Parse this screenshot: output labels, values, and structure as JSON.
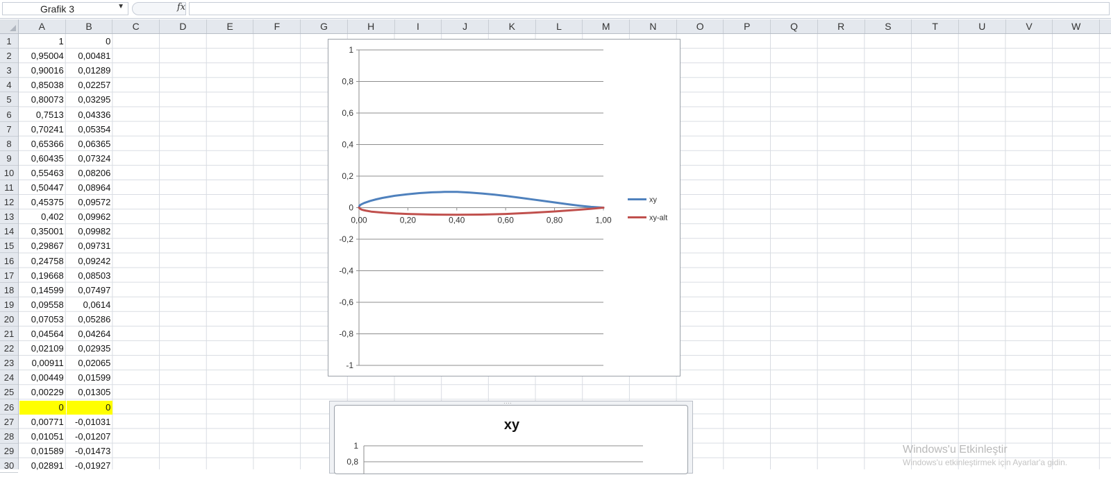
{
  "formula_bar": {
    "name_box": "Grafik 3",
    "fx_icon": "function-icon",
    "formula": ""
  },
  "columns": [
    "A",
    "B",
    "C",
    "D",
    "E",
    "F",
    "G",
    "H",
    "I",
    "J",
    "K",
    "L",
    "M",
    "N",
    "O",
    "P",
    "Q",
    "R",
    "S",
    "T",
    "U",
    "V",
    "W"
  ],
  "rows": [
    "1",
    "2",
    "3",
    "4",
    "5",
    "6",
    "7",
    "8",
    "9",
    "10",
    "11",
    "12",
    "13",
    "14",
    "15",
    "16",
    "17",
    "18",
    "19",
    "20",
    "21",
    "22",
    "23",
    "24",
    "25",
    "26",
    "27",
    "28",
    "29",
    "30"
  ],
  "cells": [
    [
      "1",
      "0"
    ],
    [
      "0,95004",
      "0,00481"
    ],
    [
      "0,90016",
      "0,01289"
    ],
    [
      "0,85038",
      "0,02257"
    ],
    [
      "0,80073",
      "0,03295"
    ],
    [
      "0,7513",
      "0,04336"
    ],
    [
      "0,70241",
      "0,05354"
    ],
    [
      "0,65366",
      "0,06365"
    ],
    [
      "0,60435",
      "0,07324"
    ],
    [
      "0,55463",
      "0,08206"
    ],
    [
      "0,50447",
      "0,08964"
    ],
    [
      "0,45375",
      "0,09572"
    ],
    [
      "0,402",
      "0,09962"
    ],
    [
      "0,35001",
      "0,09982"
    ],
    [
      "0,29867",
      "0,09731"
    ],
    [
      "0,24758",
      "0,09242"
    ],
    [
      "0,19668",
      "0,08503"
    ],
    [
      "0,14599",
      "0,07497"
    ],
    [
      "0,09558",
      "0,0614"
    ],
    [
      "0,07053",
      "0,05286"
    ],
    [
      "0,04564",
      "0,04264"
    ],
    [
      "0,02109",
      "0,02935"
    ],
    [
      "0,00911",
      "0,02065"
    ],
    [
      "0,00449",
      "0,01599"
    ],
    [
      "0,00229",
      "0,01305"
    ],
    [
      "0",
      "0"
    ],
    [
      "0,00771",
      "-0,01031"
    ],
    [
      "0,01051",
      "-0,01207"
    ],
    [
      "0,01589",
      "-0,01473"
    ],
    [
      "0,02891",
      "-0,01927"
    ]
  ],
  "highlight_row": 26,
  "highlight_color": "#ffff00",
  "chart_data": [
    {
      "type": "line",
      "title": "",
      "x_ticks": [
        "0,00",
        "0,20",
        "0,40",
        "0,60",
        "0,80",
        "1,00"
      ],
      "y_ticks": [
        "1",
        "0,8",
        "0,6",
        "0,4",
        "0,2",
        "0",
        "-0,2",
        "-0,4",
        "-0,6",
        "-0,8",
        "-1"
      ],
      "xlim": [
        0,
        1
      ],
      "ylim": [
        -1,
        1
      ],
      "grid": true,
      "legend": "right",
      "series": [
        {
          "name": "xy",
          "color": "#4f81bd",
          "x": [
            0,
            0.00229,
            0.00449,
            0.00911,
            0.02109,
            0.04564,
            0.07053,
            0.09558,
            0.14599,
            0.19668,
            0.24758,
            0.29867,
            0.35001,
            0.402,
            0.45375,
            0.50447,
            0.55463,
            0.60435,
            0.65366,
            0.70241,
            0.7513,
            0.80073,
            0.85038,
            0.90016,
            0.95004,
            1
          ],
          "y": [
            0,
            0.01305,
            0.01599,
            0.02065,
            0.02935,
            0.04264,
            0.05286,
            0.0614,
            0.07497,
            0.08503,
            0.09242,
            0.09731,
            0.09982,
            0.09962,
            0.09572,
            0.08964,
            0.08206,
            0.07324,
            0.06365,
            0.05354,
            0.04336,
            0.03295,
            0.02257,
            0.01289,
            0.00481,
            0
          ]
        },
        {
          "name": "xy-alt",
          "color": "#c0504d",
          "x": [
            0,
            0.00771,
            0.01051,
            0.01589,
            0.02891,
            0.05,
            0.1,
            0.15,
            0.2,
            0.3,
            0.4,
            0.5,
            0.6,
            0.7,
            0.8,
            0.9,
            0.95,
            1
          ],
          "y": [
            0,
            -0.01031,
            -0.01207,
            -0.01473,
            -0.01927,
            -0.025,
            -0.032,
            -0.037,
            -0.04,
            -0.044,
            -0.045,
            -0.044,
            -0.04,
            -0.033,
            -0.024,
            -0.013,
            -0.007,
            0
          ]
        }
      ]
    },
    {
      "type": "line",
      "title": "xy",
      "y_ticks": [
        "1",
        "0,8"
      ],
      "grid": true
    }
  ],
  "watermark": {
    "line1": "Windows'u Etkinleştir",
    "line2": "Windows'u etkinleştirmek için Ayarlar'a gidin."
  }
}
